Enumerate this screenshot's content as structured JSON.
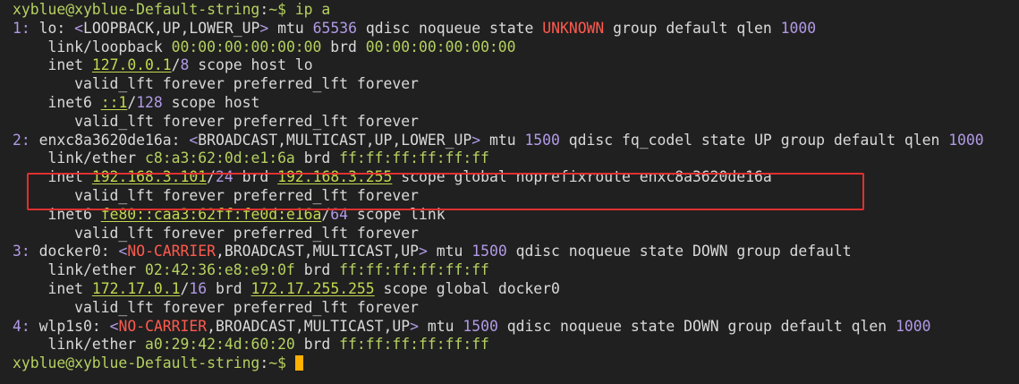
{
  "prompt": {
    "user_host": "xyblue@xyblue-Default-string",
    "path": "~",
    "symbol": "$",
    "command": "ip a"
  },
  "interfaces": [
    {
      "header": {
        "index": "1:",
        "name": "lo",
        "flags_open": "<",
        "flags_mid": "LOOPBACK,UP,LOWER_UP",
        "flags_close": ">",
        "mtu_label": "mtu",
        "mtu": "65536",
        "qdisc_label": "qdisc",
        "qdisc": "noqueue",
        "state_label": "state",
        "state": "UNKNOWN",
        "tail": "group default qlen",
        "qlen": "1000"
      },
      "link": {
        "label": "link/loopback",
        "mac": "00:00:00:00:00:00",
        "brd_label": "brd",
        "brd": "00:00:00:00:00:00"
      },
      "inet": {
        "label": "inet",
        "addr": "127.0.0.1",
        "slash": "/",
        "prefix": "8",
        "rest": "scope host lo"
      },
      "inet_lft": "valid_lft forever preferred_lft forever",
      "inet6": {
        "label": "inet6",
        "addr": "::1",
        "slash": "/",
        "prefix": "128",
        "rest": "scope host"
      },
      "inet6_lft": "valid_lft forever preferred_lft forever"
    },
    {
      "header": {
        "index": "2:",
        "name": "enxc8a3620de16a",
        "flags_open": "<",
        "flags_mid": "BROADCAST,MULTICAST,UP,LOWER_UP",
        "flags_close": ">",
        "mtu_label": "mtu",
        "mtu": "1500",
        "qdisc_label": "qdisc",
        "qdisc": "fq_codel",
        "state_label": "state",
        "state": "UP",
        "tail": "group default qlen",
        "qlen": "1000"
      },
      "link": {
        "label": "link/ether",
        "mac": "c8:a3:62:0d:e1:6a",
        "brd_label": "brd",
        "brd": "ff:ff:ff:ff:ff:ff"
      },
      "inet": {
        "label": "inet",
        "addr": "192.168.3.101",
        "slash": "/",
        "prefix": "24",
        "brd_label": "brd",
        "brd": "192.168.3.255",
        "rest": "scope global noprefixroute enxc8a3620de16a"
      },
      "inet_lft": "valid_lft forever preferred_lft forever",
      "inet6": {
        "label": "inet6",
        "addr": "fe80::caa3:62ff:fe0d:e16a",
        "slash": "/",
        "prefix": "64",
        "rest": "scope link"
      },
      "inet6_lft": "valid_lft forever preferred_lft forever"
    },
    {
      "header": {
        "index": "3:",
        "name": "docker0",
        "flags_open": "<",
        "flags_red": "NO-CARRIER",
        "flags_mid": ",BROADCAST,MULTICAST,UP",
        "flags_close": ">",
        "mtu_label": "mtu",
        "mtu": "1500",
        "qdisc_label": "qdisc",
        "qdisc": "noqueue",
        "state_label": "state",
        "state": "DOWN",
        "tail": "group default"
      },
      "link": {
        "label": "link/ether",
        "mac": "02:42:36:e8:e9:0f",
        "brd_label": "brd",
        "brd": "ff:ff:ff:ff:ff:ff"
      },
      "inet": {
        "label": "inet",
        "addr": "172.17.0.1",
        "slash": "/",
        "prefix": "16",
        "brd_label": "brd",
        "brd": "172.17.255.255",
        "rest": "scope global docker0"
      },
      "inet_lft": "valid_lft forever preferred_lft forever"
    },
    {
      "header": {
        "index": "4:",
        "name": "wlp1s0",
        "flags_open": "<",
        "flags_red": "NO-CARRIER",
        "flags_mid": ",BROADCAST,MULTICAST,UP",
        "flags_close": ">",
        "mtu_label": "mtu",
        "mtu": "1500",
        "qdisc_label": "qdisc",
        "qdisc": "noqueue",
        "state_label": "state",
        "state": "DOWN",
        "tail": "group default qlen",
        "qlen": "1000"
      },
      "link": {
        "label": "link/ether",
        "mac": "a0:29:42:4d:60:20",
        "brd_label": "brd",
        "brd": "ff:ff:ff:ff:ff:ff"
      }
    }
  ],
  "colors": {
    "background": "#202020",
    "text": "#d9d9d9",
    "prompt": "#b5d160",
    "number": "#b29ae6",
    "warning": "#ff5a4e",
    "address": "#c4d84f",
    "cursor": "#ffb000",
    "highlight_box": "#e03030"
  }
}
